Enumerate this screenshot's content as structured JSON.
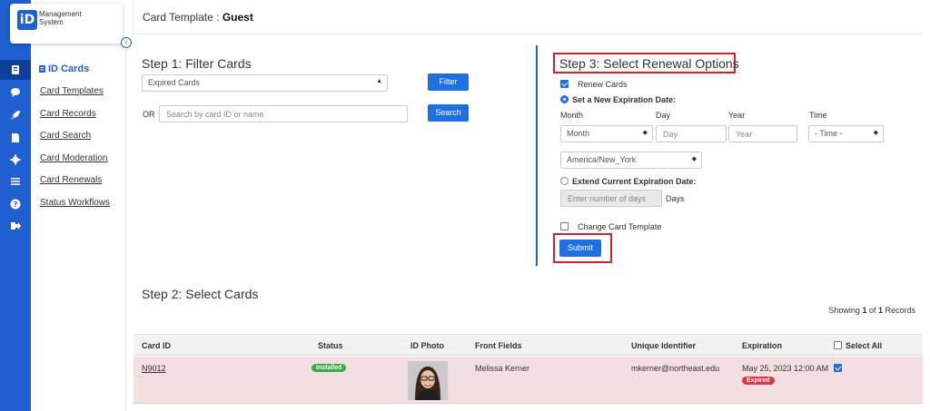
{
  "logo": {
    "mark": "iD",
    "line1": "Management",
    "line2": "System"
  },
  "rail_icons": [
    "id-card-icon",
    "chat-icon",
    "rocket-icon",
    "document-icon",
    "gear-icon",
    "list-icon",
    "help-icon",
    "logout-icon"
  ],
  "sidebar": {
    "collapse_glyph": "‹",
    "title": "ID Cards",
    "items": [
      {
        "label": "Card Templates"
      },
      {
        "label": "Card Records"
      },
      {
        "label": "Card Search"
      },
      {
        "label": "Card Moderation"
      },
      {
        "label": "Card Renewals"
      },
      {
        "label": "Status Workflows"
      }
    ]
  },
  "header": {
    "prefix": "Card Template : ",
    "value": "Guest"
  },
  "step1": {
    "title": "Step 1: Filter Cards",
    "filter_select": "Expired Cards",
    "filter_button": "Filter",
    "or_label": "OR",
    "search_placeholder": "Search by card ID or name",
    "search_button": "Search"
  },
  "step3": {
    "title": "Step 3: Select Renewal Options",
    "renew_cards_label": "Renew Cards",
    "renew_cards_checked": true,
    "set_new_label": "Set a New Expiration Date:",
    "col_month": "Month",
    "col_day": "Day",
    "col_year": "Year",
    "col_time": "Time",
    "month_select": "Month",
    "day_placeholder": "Day",
    "year_placeholder": "Year",
    "time_select": "- Time -",
    "timezone_select": "America/New_York",
    "extend_label": "Extend Current Expiration Date:",
    "days_placeholder": "Enter number of days",
    "days_suffix": "Days",
    "change_template_label": "Change Card Template",
    "change_template_checked": false,
    "submit_button": "Submit"
  },
  "step2": {
    "title": "Step 2: Select Cards",
    "showing_prefix": "Showing ",
    "showing_current": "1",
    "showing_of": " of ",
    "showing_total": "1",
    "showing_suffix": " Records",
    "columns": {
      "card_id": "Card ID",
      "status": "Status",
      "id_photo": "ID Photo",
      "front_fields": "Front Fields",
      "unique_identifier": "Unique Identifier",
      "expiration": "Expiration",
      "select_all": "Select All"
    },
    "rows": [
      {
        "card_id": "N9012",
        "status": "Installed",
        "front_fields": "Melissa Kerner",
        "unique_identifier": "mkerner@northeast.edu",
        "expiration": "May 25, 2023 12:00 AM",
        "expired_badge": "Expired",
        "selected": true
      }
    ]
  },
  "colors": {
    "primary": "#1f5fcf",
    "button": "#1f6fe0",
    "highlight": "#d2232a",
    "expired_row": "#f4dfe0",
    "installed": "#3aa94a",
    "expired": "#dc3545"
  }
}
